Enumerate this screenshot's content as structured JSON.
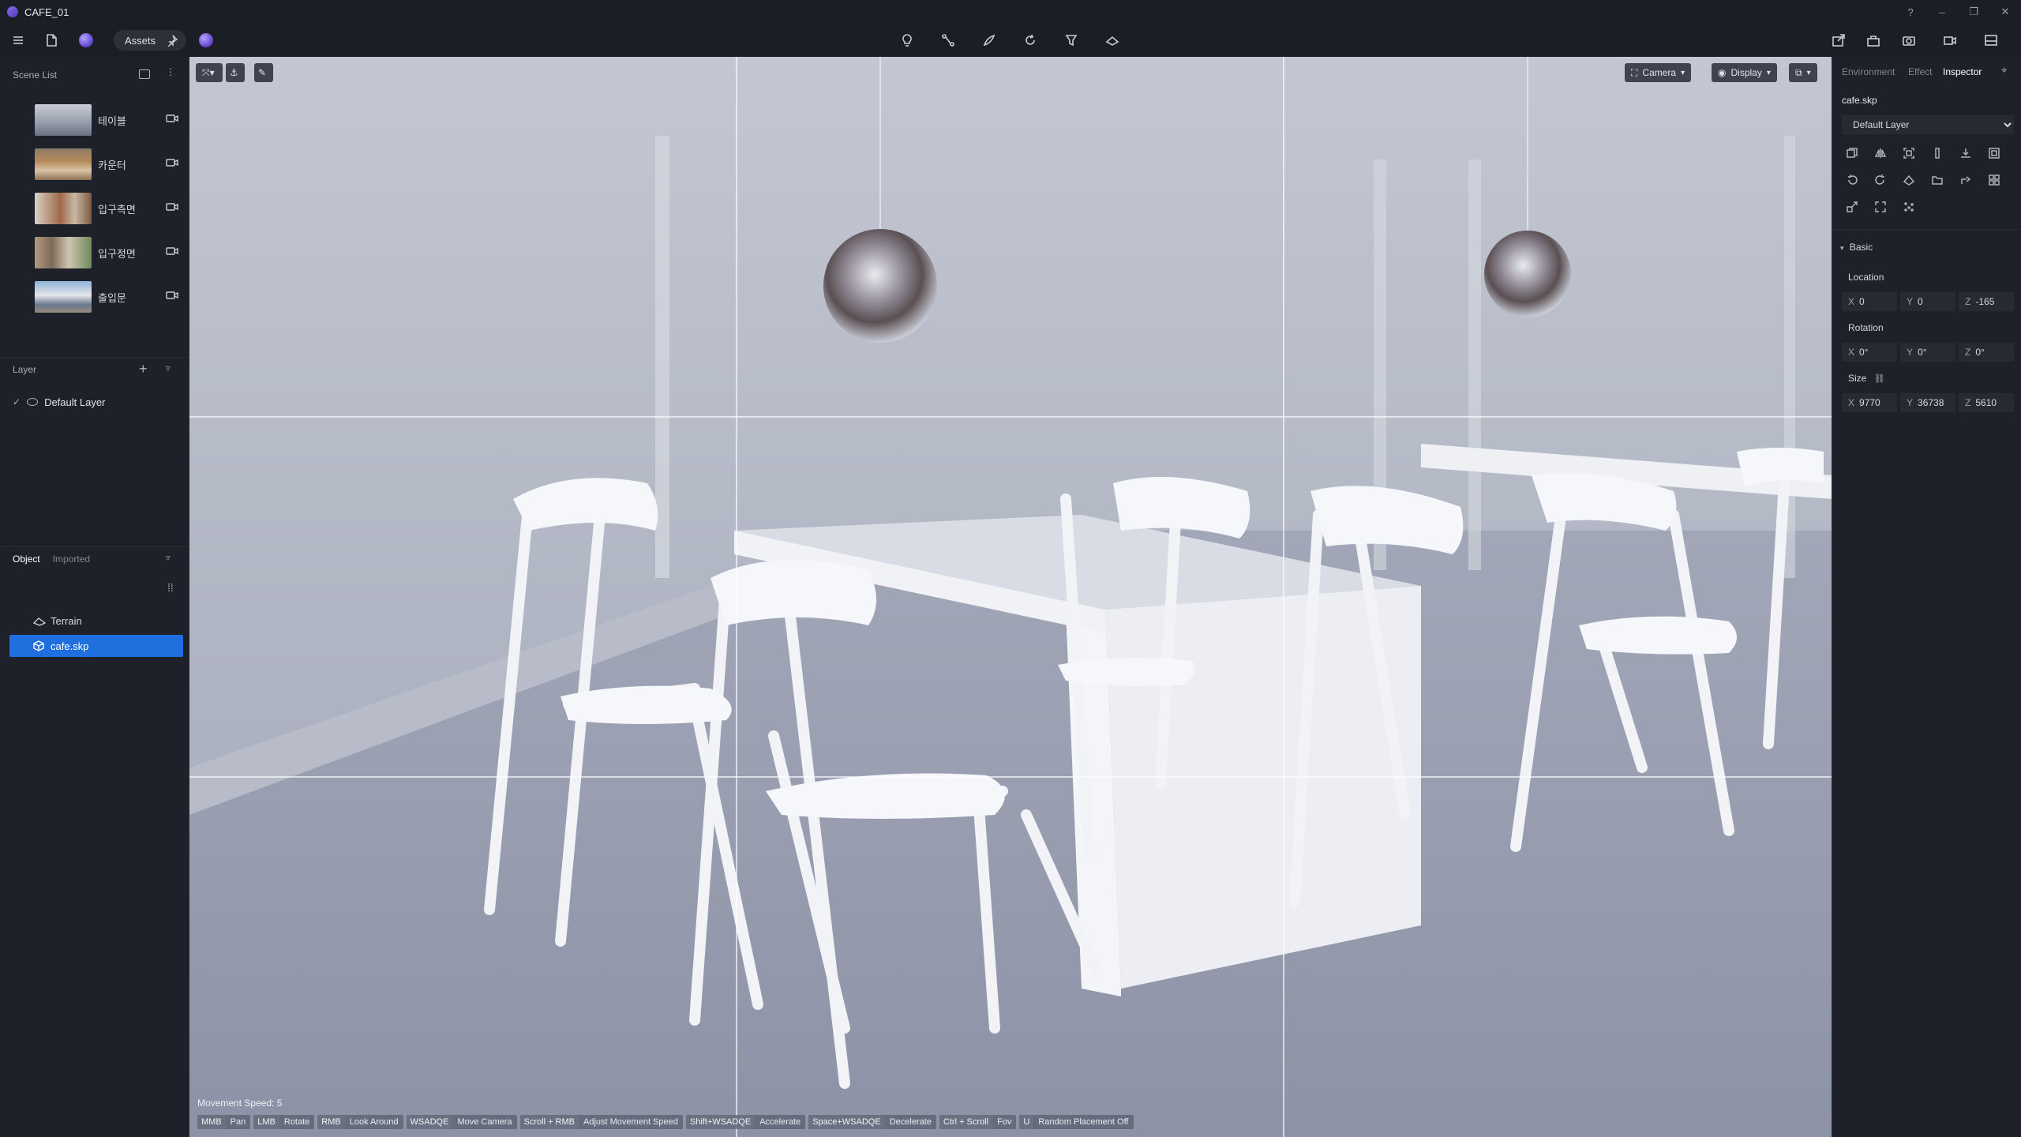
{
  "window": {
    "title": "CAFE_01"
  },
  "toolbar": {
    "assets_label": "Assets"
  },
  "left_panel": {
    "scene_list_title": "Scene List",
    "scenes": [
      {
        "label": "테이블"
      },
      {
        "label": "카운터"
      },
      {
        "label": "입구측면"
      },
      {
        "label": "입구정면"
      },
      {
        "label": "출입문"
      }
    ],
    "layer_title": "Layer",
    "layers": [
      {
        "label": "Default Layer",
        "visible": true
      }
    ],
    "object_tab": "Object",
    "imported_tab": "Imported",
    "search_placeholder": "",
    "objects": [
      {
        "label": "Terrain",
        "selected": false
      },
      {
        "label": "cafe.skp",
        "selected": true
      }
    ]
  },
  "viewport": {
    "camera_label": "Camera",
    "display_label": "Display",
    "movement_speed": "Movement Speed: 5",
    "hints": [
      {
        "key": "MMB",
        "action": "Pan"
      },
      {
        "key": "LMB",
        "action": "Rotate"
      },
      {
        "key": "RMB",
        "action": "Look Around"
      },
      {
        "key": "WSADQE",
        "action": "Move Camera"
      },
      {
        "key": "Scroll + RMB",
        "action": "Adjust Movement Speed"
      },
      {
        "key": "Shift+WSADQE",
        "action": "Accelerate"
      },
      {
        "key": "Space+WSADQE",
        "action": "Decelerate"
      },
      {
        "key": "Ctrl + Scroll",
        "action": "Fov"
      },
      {
        "key": "U",
        "action": "Random Placement Off"
      }
    ]
  },
  "right_panel": {
    "tabs": [
      {
        "label": "Environment",
        "active": false
      },
      {
        "label": "Effect",
        "active": false
      },
      {
        "label": "Inspector",
        "active": true
      }
    ],
    "object_name": "cafe.skp",
    "layer_value": "Default Layer",
    "basic_label": "Basic",
    "location": {
      "label": "Location",
      "x": "0",
      "y": "0",
      "z": "-165"
    },
    "rotation": {
      "label": "Rotation",
      "x": "0°",
      "y": "0°",
      "z": "0°"
    },
    "size": {
      "label": "Size",
      "x": "9770",
      "y": "36738",
      "z": "5610"
    }
  },
  "colors": {
    "accent": "#1f6fde",
    "panel": "#1e2129",
    "background": "#1b1e25"
  }
}
